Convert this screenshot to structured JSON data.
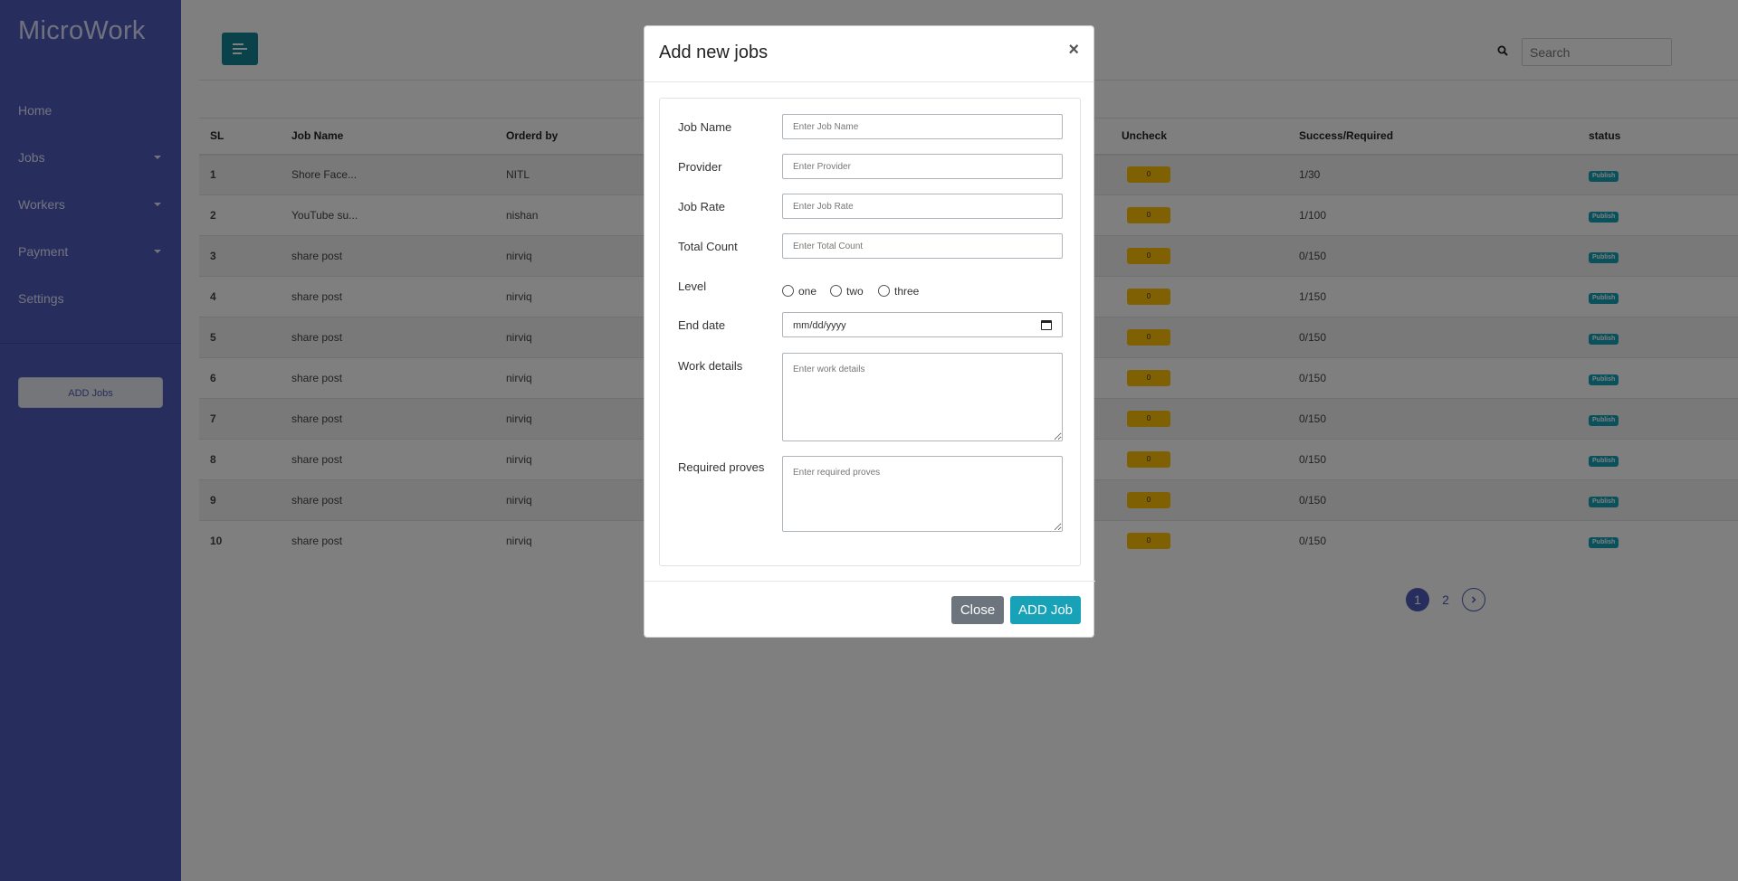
{
  "app": {
    "brand": "MicroWork"
  },
  "sidebar": {
    "items": [
      {
        "label": "Home",
        "has_caret": false
      },
      {
        "label": "Jobs",
        "has_caret": true
      },
      {
        "label": "Workers",
        "has_caret": true
      },
      {
        "label": "Payment",
        "has_caret": true
      },
      {
        "label": "Settings",
        "has_caret": false
      }
    ],
    "add_jobs_label": "ADD Jobs"
  },
  "header": {
    "search_placeholder": "Search"
  },
  "table": {
    "columns": [
      "SL",
      "Job Name",
      "Orderd by",
      "Uncheck",
      "Success/Required",
      "status"
    ],
    "rows": [
      {
        "sl": "1",
        "job": "Shore Face...",
        "by": "NITL",
        "uncheck": "0",
        "success": "1/30",
        "status": "Publish"
      },
      {
        "sl": "2",
        "job": "YouTube su...",
        "by": "nishan",
        "uncheck": "0",
        "success": "1/100",
        "status": "Publish"
      },
      {
        "sl": "3",
        "job": "share post",
        "by": "nirviq",
        "uncheck": "0",
        "success": "0/150",
        "status": "Publish"
      },
      {
        "sl": "4",
        "job": "share post",
        "by": "nirviq",
        "uncheck": "0",
        "success": "1/150",
        "status": "Publish"
      },
      {
        "sl": "5",
        "job": "share post",
        "by": "nirviq",
        "uncheck": "0",
        "success": "0/150",
        "status": "Publish"
      },
      {
        "sl": "6",
        "job": "share post",
        "by": "nirviq",
        "uncheck": "0",
        "success": "0/150",
        "status": "Publish"
      },
      {
        "sl": "7",
        "job": "share post",
        "by": "nirviq",
        "uncheck": "0",
        "success": "0/150",
        "status": "Publish"
      },
      {
        "sl": "8",
        "job": "share post",
        "by": "nirviq",
        "uncheck": "0",
        "success": "0/150",
        "status": "Publish"
      },
      {
        "sl": "9",
        "job": "share post",
        "by": "nirviq",
        "uncheck": "0",
        "success": "0/150",
        "status": "Publish"
      },
      {
        "sl": "10",
        "job": "share post",
        "by": "nirviq",
        "uncheck": "0",
        "success": "0/150",
        "status": "Publish"
      }
    ]
  },
  "pagination": {
    "pages": [
      "1",
      "2"
    ],
    "current": "1",
    "next_icon": "chevron-right-icon"
  },
  "modal": {
    "title": "Add new jobs",
    "close_icon": "×",
    "fields": {
      "job_name": {
        "label": "Job Name",
        "placeholder": "Enter Job Name"
      },
      "provider": {
        "label": "Provider",
        "placeholder": "Enter Provider"
      },
      "job_rate": {
        "label": "Job Rate",
        "placeholder": "Enter Job Rate"
      },
      "total_count": {
        "label": "Total Count",
        "placeholder": "Enter Total Count"
      },
      "level": {
        "label": "Level",
        "options": [
          "one",
          "two",
          "three"
        ]
      },
      "end_date": {
        "label": "End date",
        "placeholder": "mm/dd/yyyy"
      },
      "work_details": {
        "label": "Work details",
        "placeholder": "Enter work details"
      },
      "required_proves": {
        "label": "Required proves",
        "placeholder": "Enter required proves"
      }
    },
    "close_label": "Close",
    "submit_label": "ADD Job"
  },
  "colors": {
    "sidebar": "#4e5ab9",
    "primary": "#138496",
    "info": "#17a2b8",
    "warning": "#ffc107",
    "secondary": "#6c757d"
  }
}
